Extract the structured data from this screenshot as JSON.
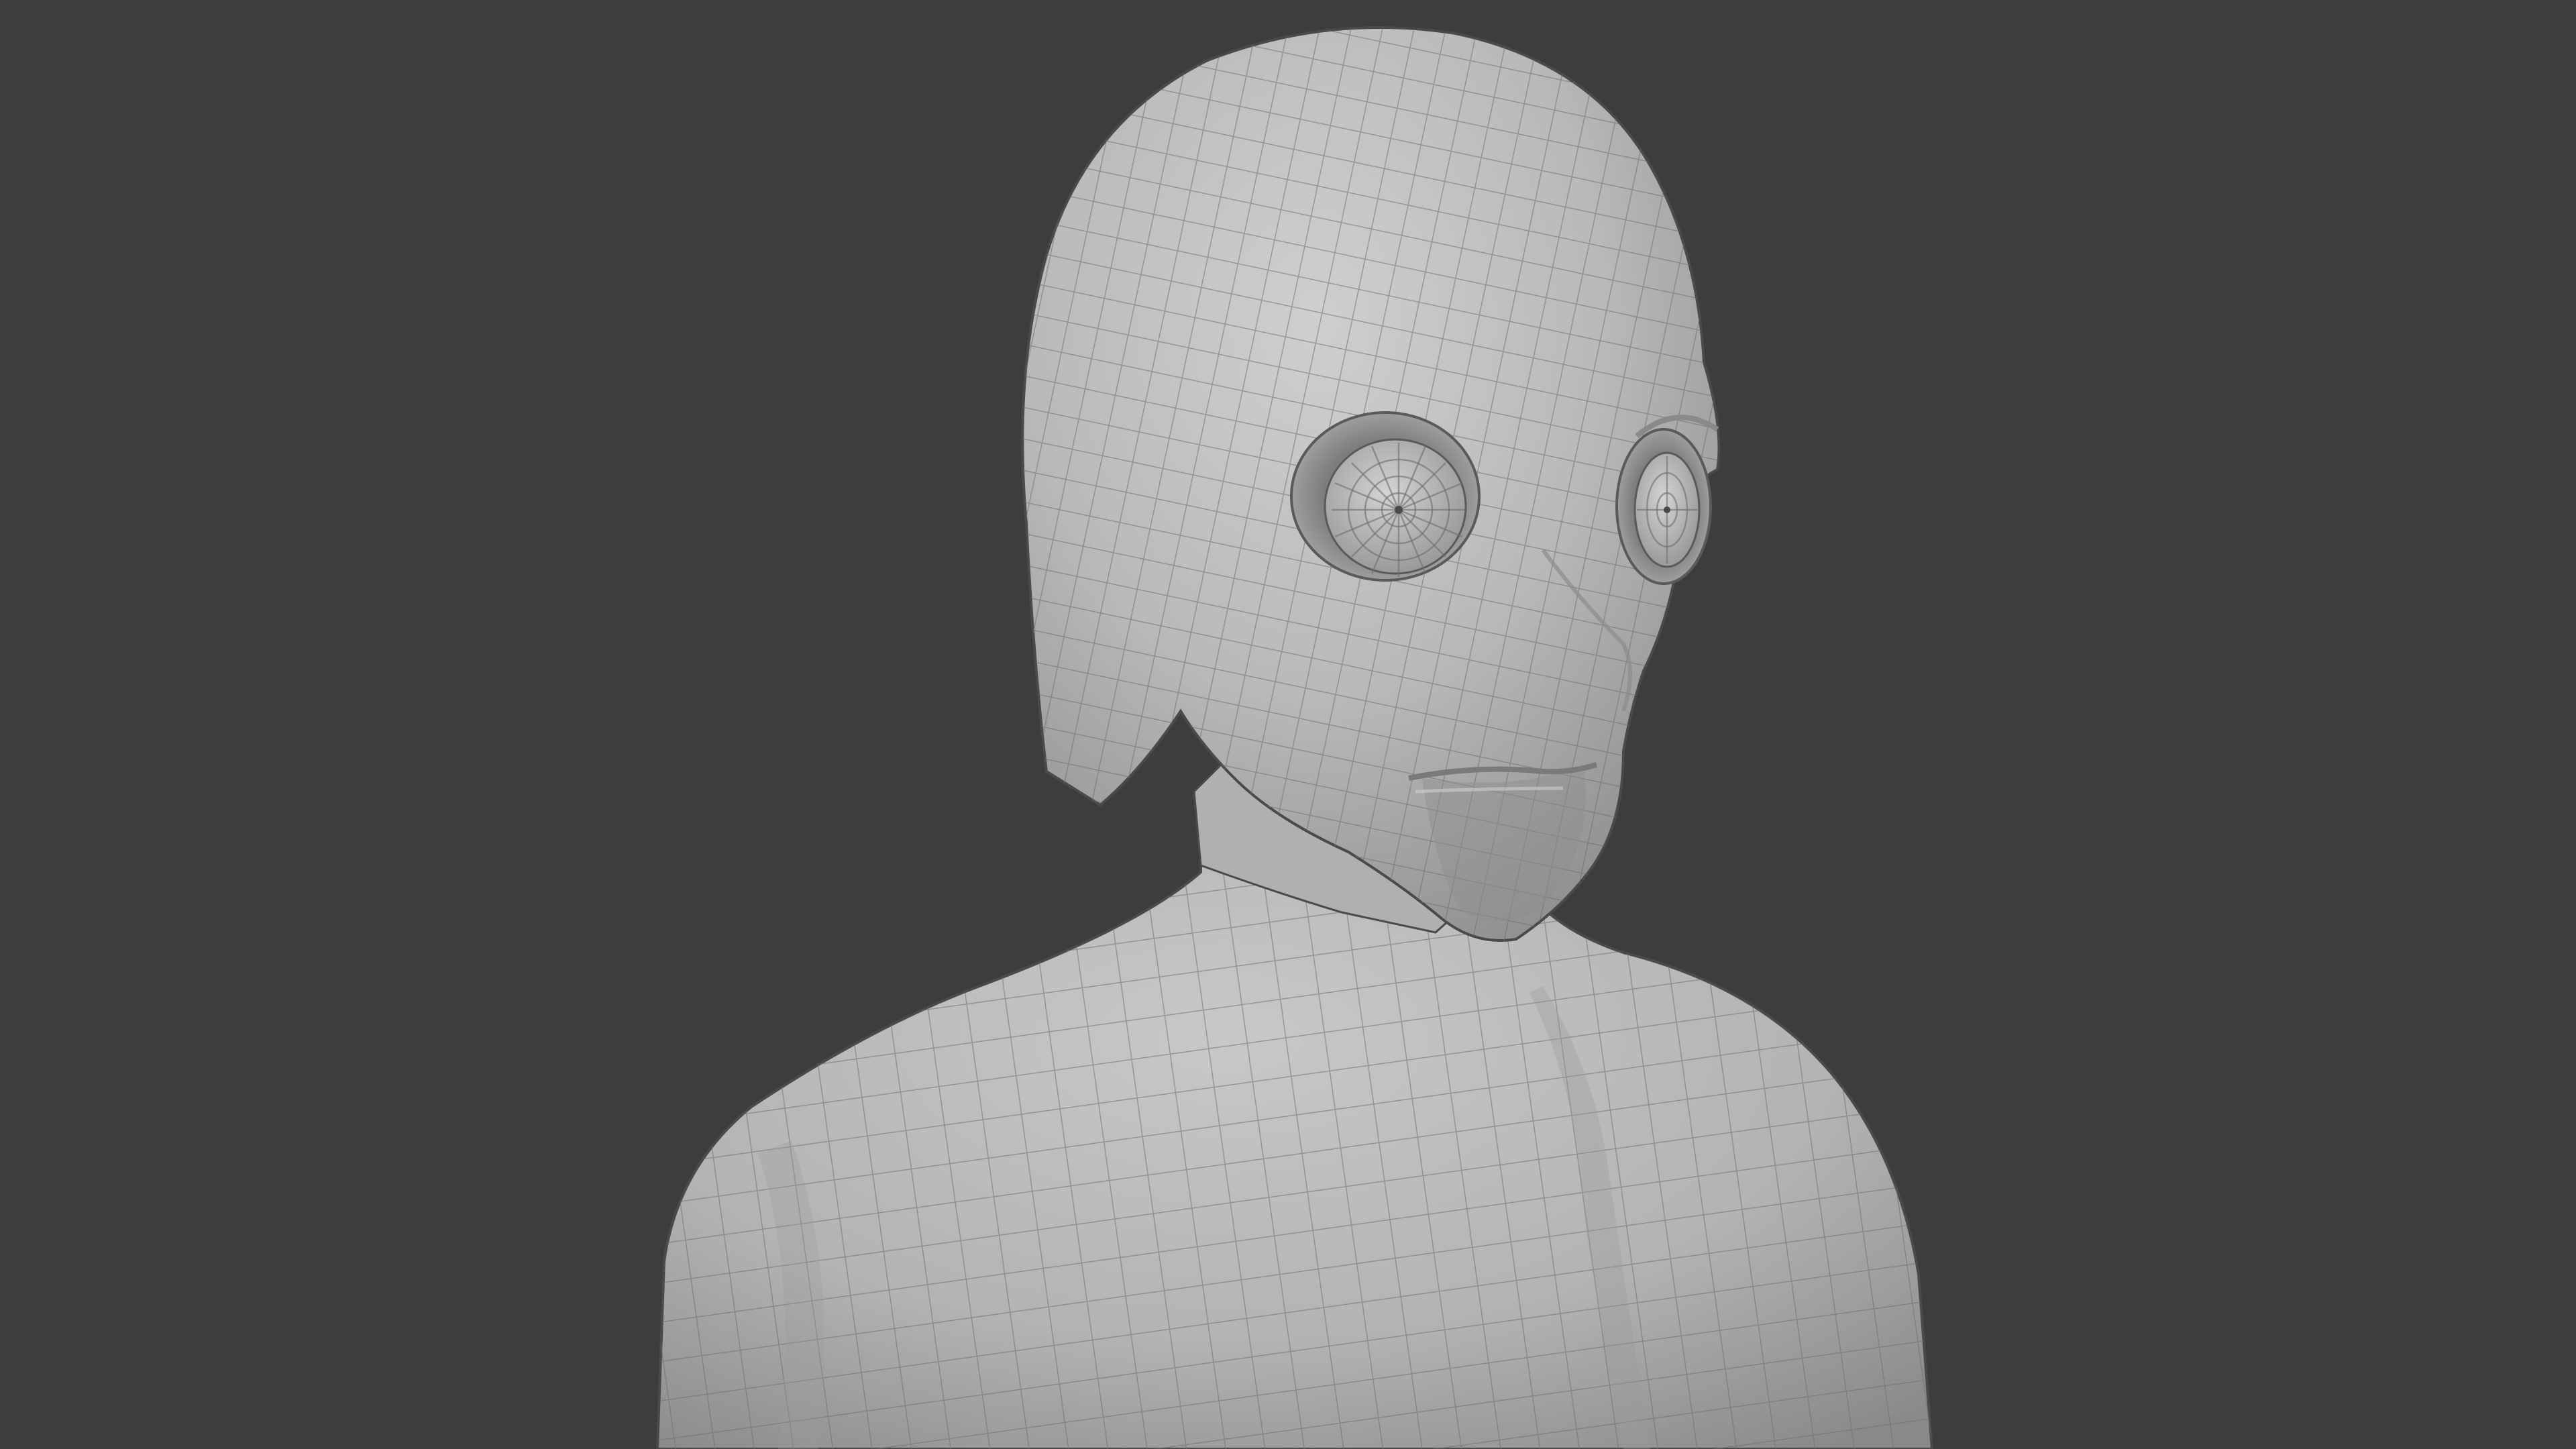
{
  "viewport": {
    "background_color": "#3d3d3d",
    "object": "alien-character-bust",
    "shading": "solid",
    "overlay": "wireframe",
    "surface_color": "#b8b8b8",
    "wire_color": "#6e6e6e"
  }
}
